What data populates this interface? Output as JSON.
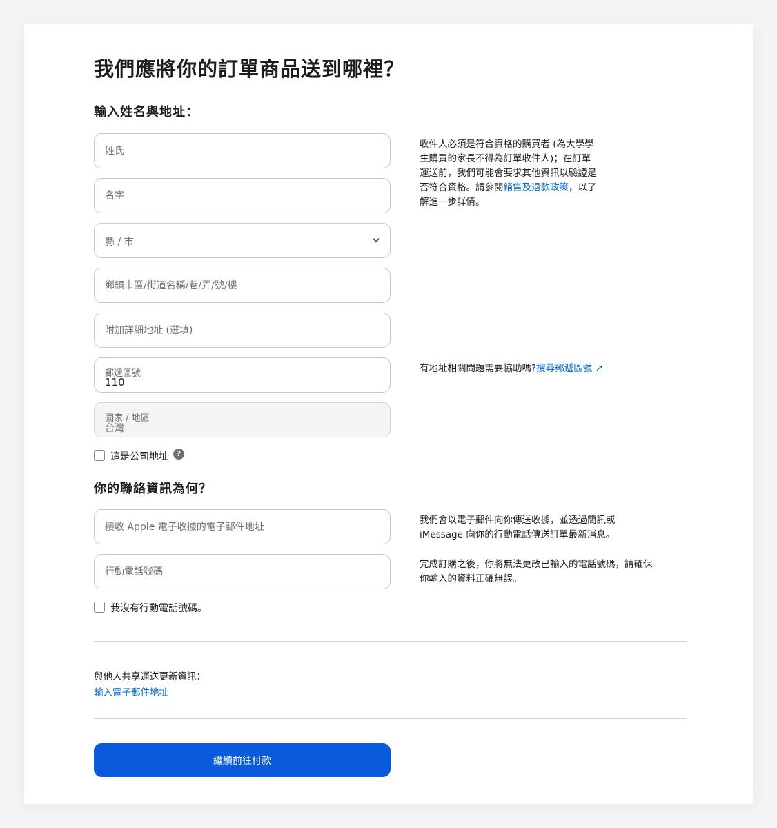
{
  "page_title": "我們應將你的訂單商品送到哪裡？",
  "address_section": {
    "title": "輸入姓名與地址：",
    "last_name_placeholder": "姓氏",
    "first_name_placeholder": "名字",
    "county_city_label": "縣 / 市",
    "street_placeholder": "鄉鎮市區/街道名稱/巷/弄/號/樓",
    "address_line2_placeholder": "附加詳細地址 (選填)",
    "postal_code_label": "郵遞區號",
    "postal_code_value": "110",
    "country_label": "國家 / 地區",
    "country_value": "台灣",
    "business_address_label": "這是公司地址",
    "help_glyph": "?"
  },
  "eligibility_note": {
    "text_before_link": "收件人必須是符合資格的購買者 (為大學學生購買的家長不得為訂單收件人)；在訂單運送前，我們可能會要求其他資訊以驗證是否符合資格。請參閱",
    "link_text": "銷售及退款政策",
    "text_after_link": "，以了解進一步詳情。"
  },
  "address_help": {
    "text": "有地址相關問題需要協助嗎?",
    "link_text": "搜尋郵遞區號",
    "link_arrow": "↗"
  },
  "contact_section": {
    "title": "你的聯絡資訊為何？",
    "email_placeholder": "接收 Apple 電子收據的電子郵件地址",
    "phone_placeholder": "行動電話號碼",
    "no_phone_label": "我沒有行動電話號碼。"
  },
  "contact_notes": {
    "note1": "我們會以電子郵件向你傳送收據，並透過簡訊或 iMessage 向你的行動電話傳送訂單最新消息。",
    "note2": "完成訂購之後，你將無法更改已輸入的電話號碼，請確保你輸入的資料正確無誤。"
  },
  "share_updates": {
    "label": "與他人共享運送更新資訊：",
    "link_text": "輸入電子郵件地址"
  },
  "continue_button_label": "繼續前往付款",
  "colors": {
    "accent": "#0a5bdb",
    "link": "#0066cc",
    "text": "#1d1d1f",
    "muted": "#6e6e73"
  }
}
